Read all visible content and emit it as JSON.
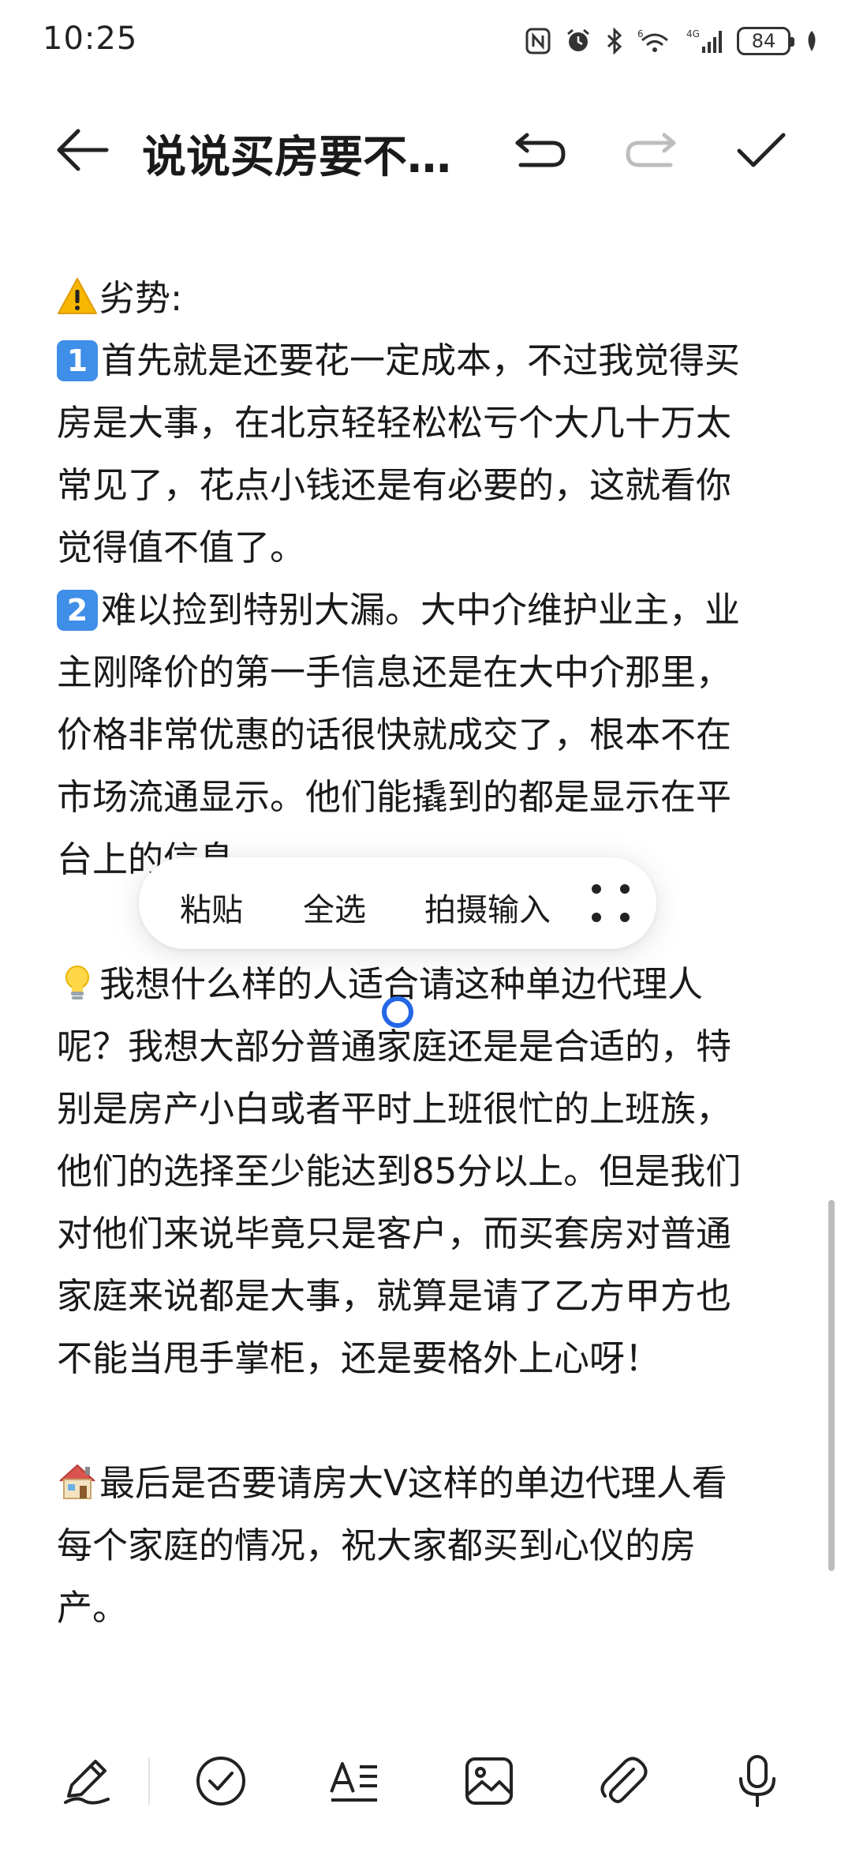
{
  "status_bar": {
    "time": "10:25",
    "battery": "84",
    "network": "4G",
    "wifi_label": "6"
  },
  "toolbar": {
    "title": "说说买房要不…"
  },
  "content": {
    "lines": [
      {
        "icon": "warning-icon",
        "text": "劣势:"
      },
      {
        "badge": "1",
        "text": "首先就是还要花一定成本，不过我觉得买"
      },
      {
        "text": "房是大事，在北京轻轻松松亏个大几十万太"
      },
      {
        "text": "常见了，花点小钱还是有必要的，这就看你"
      },
      {
        "text": "觉得值不值了。"
      },
      {
        "badge": "2",
        "text": "难以捡到特别大漏。大中介维护业主，业"
      },
      {
        "text": "主刚降价的第一手信息还是在大中介那里，"
      },
      {
        "text": "价格非常优惠的话很快就成交了，根本不在"
      },
      {
        "text": "市场流通显示。他们能撬到的都是显示在平"
      },
      {
        "text": "台上的信息。"
      },
      {
        "blank": true
      },
      {
        "icon": "lightbulb-icon",
        "text": "我想什么样的人适合请这种单边代理人"
      },
      {
        "text": "呢？我想大部分普通家庭还是是合适的，特"
      },
      {
        "text": "别是房产小白或者平时上班很忙的上班族，"
      },
      {
        "text": "他们的选择至少能达到85分以上。但是我们"
      },
      {
        "text": "对他们来说毕竟只是客户，而买套房对普通"
      },
      {
        "text": "家庭来说都是大事，就算是请了乙方甲方也"
      },
      {
        "text": "不能当甩手掌柜，还是要格外上心呀！"
      },
      {
        "blank": true
      },
      {
        "icon": "house-icon",
        "text": "最后是否要请房大V这样的单边代理人看"
      },
      {
        "text": "每个家庭的情况，祝大家都买到心仪的房"
      },
      {
        "text": "产。"
      }
    ]
  },
  "context_menu": {
    "paste": "粘贴",
    "select_all": "全选",
    "camera_input": "拍摄输入"
  },
  "colors": {
    "accent_blue": "#2467e6",
    "badge_blue": "#3f8ee8",
    "text": "#1a1a1a"
  },
  "bottom_bar": {
    "buttons": [
      "pen-icon",
      "checklist-icon",
      "text-format-icon",
      "image-icon",
      "attachment-icon",
      "microphone-icon"
    ]
  }
}
